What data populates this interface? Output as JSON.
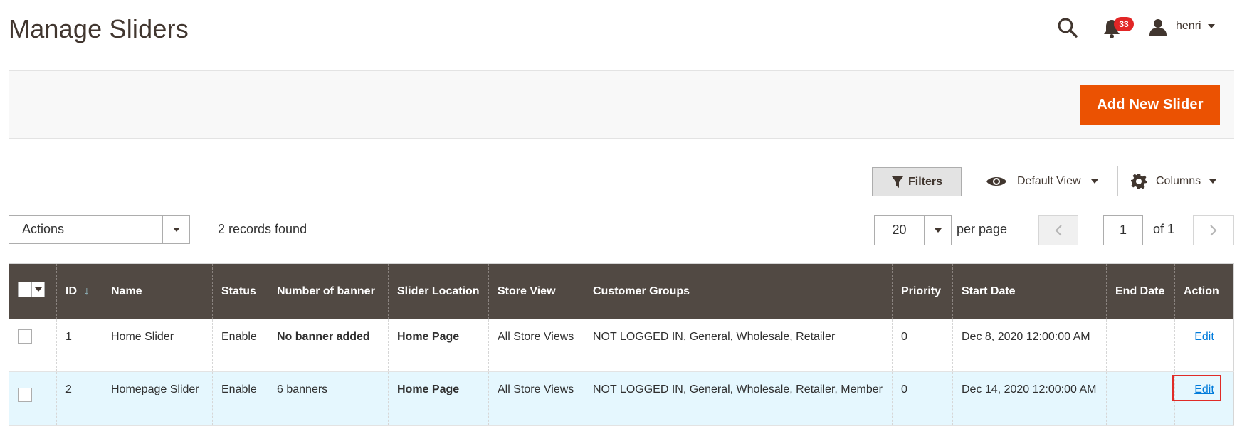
{
  "header": {
    "title": "Manage Sliders",
    "notification_count": "33",
    "user_name": "henri"
  },
  "action_bar": {
    "add_button_label": "Add New Slider"
  },
  "toolbar": {
    "filters_label": "Filters",
    "view_label": "Default View",
    "columns_label": "Columns"
  },
  "controls": {
    "actions_label": "Actions",
    "records_found": "2 records found",
    "per_page_value": "20",
    "per_page_label": "per page",
    "current_page": "1",
    "total_pages_label": "of 1"
  },
  "table": {
    "columns": [
      "ID",
      "Name",
      "Status",
      "Number of banner",
      "Slider Location",
      "Store View",
      "Customer Groups",
      "Priority",
      "Start Date",
      "End Date",
      "Action"
    ],
    "rows": [
      {
        "id": "1",
        "name": "Home Slider",
        "status": "Enable",
        "banners": "No banner added",
        "location": "Home Page",
        "store_view": "All Store Views",
        "groups": "NOT LOGGED IN, General, Wholesale, Retailer",
        "priority": "0",
        "start_date": "Dec 8, 2020 12:00:00 AM",
        "end_date": "",
        "action": "Edit"
      },
      {
        "id": "2",
        "name": "Homepage Slider",
        "status": "Enable",
        "banners": "6 banners",
        "location": "Home Page",
        "store_view": "All Store Views",
        "groups": "NOT LOGGED IN, General, Wholesale, Retailer, Member",
        "priority": "0",
        "start_date": "Dec 14, 2020 12:00:00 AM",
        "end_date": "",
        "action": "Edit"
      }
    ]
  },
  "colors": {
    "accent": "#eb5202",
    "table_header": "#514943",
    "link": "#007bdb",
    "badge": "#e22626",
    "highlight_row": "#e5f7fe"
  }
}
